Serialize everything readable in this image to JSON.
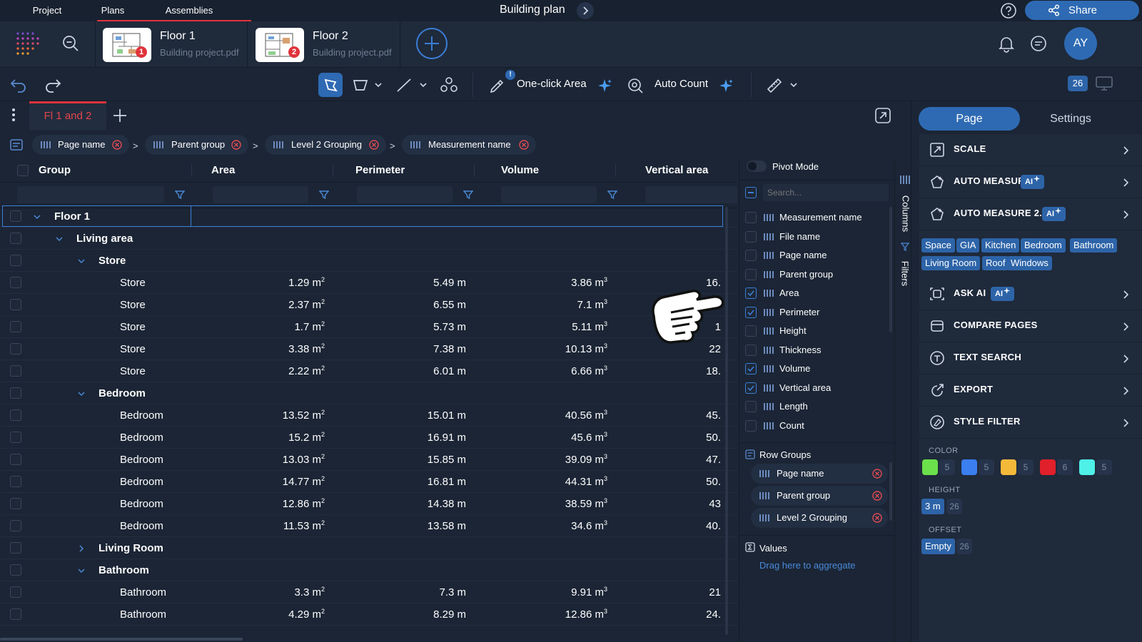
{
  "topbar": {
    "tabs": [
      "Project",
      "Plans",
      "Assemblies"
    ],
    "title": "Building plan",
    "share_label": "Share"
  },
  "files": [
    {
      "title": "Floor 1",
      "subtitle": "Building project.pdf",
      "badge": "1"
    },
    {
      "title": "Floor 2",
      "subtitle": "Building project.pdf",
      "badge": "2"
    }
  ],
  "user_initials": "AY",
  "toolbar": {
    "one_click_area": "One-click Area",
    "auto_count": "Auto Count",
    "count_badge": "26"
  },
  "sheet_tab": "Fl 1 and 2",
  "group_chips": [
    "Page name",
    "Parent group",
    "Level 2 Grouping",
    "Measurement name"
  ],
  "table": {
    "headers": [
      "Group",
      "Area",
      "Perimeter",
      "Volume",
      "Vertical area"
    ],
    "rows": [
      {
        "label": "Floor 1",
        "level": 0,
        "group": true,
        "expanded": true,
        "selected": true
      },
      {
        "label": "Living area",
        "level": 1,
        "group": true,
        "expanded": true
      },
      {
        "label": "Store",
        "level": 2,
        "group": true,
        "expanded": true
      },
      {
        "label": "Store",
        "level": 3,
        "area": "1.29",
        "perimeter": "5.49 m",
        "volume": "3.86",
        "vertical": "16."
      },
      {
        "label": "Store",
        "level": 3,
        "area": "2.37",
        "perimeter": "6.55 m",
        "volume": "7.1",
        "vertical": ""
      },
      {
        "label": "Store",
        "level": 3,
        "area": "1.7",
        "perimeter": "5.73 m",
        "volume": "5.11",
        "vertical": "1"
      },
      {
        "label": "Store",
        "level": 3,
        "area": "3.38",
        "perimeter": "7.38 m",
        "volume": "10.13",
        "vertical": "22"
      },
      {
        "label": "Store",
        "level": 3,
        "area": "2.22",
        "perimeter": "6.01 m",
        "volume": "6.66",
        "vertical": "18."
      },
      {
        "label": "Bedroom",
        "level": 2,
        "group": true,
        "expanded": true
      },
      {
        "label": "Bedroom",
        "level": 3,
        "area": "13.52",
        "perimeter": "15.01 m",
        "volume": "40.56",
        "vertical": "45."
      },
      {
        "label": "Bedroom",
        "level": 3,
        "area": "15.2",
        "perimeter": "16.91 m",
        "volume": "45.6",
        "vertical": "50."
      },
      {
        "label": "Bedroom",
        "level": 3,
        "area": "13.03",
        "perimeter": "15.85 m",
        "volume": "39.09",
        "vertical": "47."
      },
      {
        "label": "Bedroom",
        "level": 3,
        "area": "14.77",
        "perimeter": "16.81 m",
        "volume": "44.31",
        "vertical": "50."
      },
      {
        "label": "Bedroom",
        "level": 3,
        "area": "12.86",
        "perimeter": "14.38 m",
        "volume": "38.59",
        "vertical": "43"
      },
      {
        "label": "Bedroom",
        "level": 3,
        "area": "11.53",
        "perimeter": "13.58 m",
        "volume": "34.6",
        "vertical": "40."
      },
      {
        "label": "Living Room",
        "level": 2,
        "group": true,
        "expanded": false
      },
      {
        "label": "Bathroom",
        "level": 2,
        "group": true,
        "expanded": true
      },
      {
        "label": "Bathroom",
        "level": 3,
        "area": "3.3",
        "perimeter": "7.3 m",
        "volume": "9.91",
        "vertical": "21"
      },
      {
        "label": "Bathroom",
        "level": 3,
        "area": "4.29",
        "perimeter": "8.29 m",
        "volume": "12.86",
        "vertical": "24."
      }
    ]
  },
  "columns_panel": {
    "pivot_mode": "Pivot Mode",
    "search_placeholder": "Search...",
    "columns": [
      {
        "name": "Measurement name",
        "checked": false
      },
      {
        "name": "File name",
        "checked": false
      },
      {
        "name": "Page name",
        "checked": false
      },
      {
        "name": "Parent group",
        "checked": false
      },
      {
        "name": "Area",
        "checked": true
      },
      {
        "name": "Perimeter",
        "checked": true
      },
      {
        "name": "Height",
        "checked": false
      },
      {
        "name": "Thickness",
        "checked": false
      },
      {
        "name": "Volume",
        "checked": true
      },
      {
        "name": "Vertical area",
        "checked": true
      },
      {
        "name": "Length",
        "checked": false
      },
      {
        "name": "Count",
        "checked": false
      }
    ],
    "row_groups_label": "Row Groups",
    "row_groups": [
      "Page name",
      "Parent group",
      "Level 2 Grouping"
    ],
    "values_label": "Values",
    "values_hint": "Drag here to aggregate",
    "side_tabs": [
      "Columns",
      "Filters"
    ]
  },
  "right_panel": {
    "tabs": [
      "Page",
      "Settings"
    ],
    "items": [
      {
        "label": "SCALE",
        "icon": "scale-icon"
      },
      {
        "label": "AUTO MEASURE",
        "icon": "auto-measure-icon",
        "ai": "AI"
      },
      {
        "label": "AUTO MEASURE 2.0",
        "icon": "auto-measure-icon",
        "ai": "AI"
      },
      {
        "label": "ASK AI",
        "icon": "ask-ai-icon",
        "ai": "AI"
      },
      {
        "label": "COMPARE PAGES",
        "icon": "compare-icon"
      },
      {
        "label": "TEXT SEARCH",
        "icon": "text-search-icon"
      },
      {
        "label": "EXPORT",
        "icon": "export-icon"
      },
      {
        "label": "STYLE FILTER",
        "icon": "style-filter-icon"
      }
    ],
    "tags_row1": [
      "Space",
      "GIA",
      "Kitchen",
      "Bedroom",
      "Bathroom"
    ],
    "tags_row2": [
      "Living Room",
      "Roof",
      "Windows"
    ],
    "color_label": "COLOR",
    "colors": [
      {
        "hex": "#6be04a",
        "count": "5"
      },
      {
        "hex": "#3b7ef0",
        "count": "5"
      },
      {
        "hex": "#f5b93a",
        "count": "5"
      },
      {
        "hex": "#e0202a",
        "count": "6"
      },
      {
        "hex": "#4ef0e8",
        "count": "5"
      }
    ],
    "height_label": "HEIGHT",
    "height_value": "3 m",
    "height_count": "26",
    "offset_label": "OFFSET",
    "offset_value": "Empty",
    "offset_count": "26"
  }
}
